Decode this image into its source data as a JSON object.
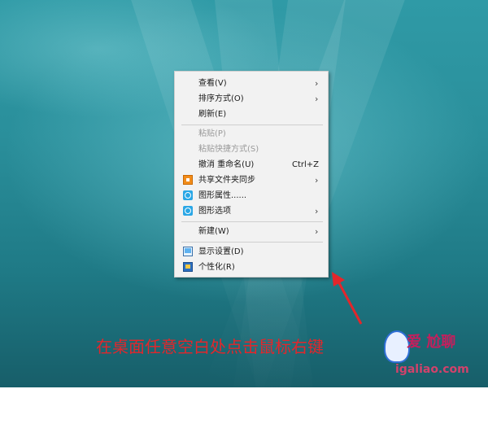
{
  "menu": {
    "items": [
      {
        "label": "查看(V)",
        "submenu": true
      },
      {
        "label": "排序方式(O)",
        "submenu": true
      },
      {
        "label": "刷新(E)"
      },
      {
        "label": "粘贴(P)",
        "disabled": true
      },
      {
        "label": "粘贴快捷方式(S)",
        "disabled": true
      },
      {
        "label": "撤消 重命名(U)",
        "shortcut": "Ctrl+Z"
      },
      {
        "label": "共享文件夹同步",
        "icon": "sync-icon",
        "submenu": true
      },
      {
        "label": "图形属性......",
        "icon": "graphics-icon"
      },
      {
        "label": "图形选项",
        "icon": "graphics-options-icon",
        "submenu": true
      },
      {
        "label": "新建(W)",
        "submenu": true
      },
      {
        "label": "显示设置(D)",
        "icon": "display-icon"
      },
      {
        "label": "个性化(R)",
        "icon": "personalize-icon"
      }
    ]
  },
  "caption": "在桌面任意空白处点击鼠标右键",
  "watermark": {
    "text": "爱 尬聊",
    "url": "igaliao.com"
  },
  "colors": {
    "caption": "#e3262b",
    "arrow": "#e3262b",
    "menu_bg": "#f2f2f2"
  }
}
